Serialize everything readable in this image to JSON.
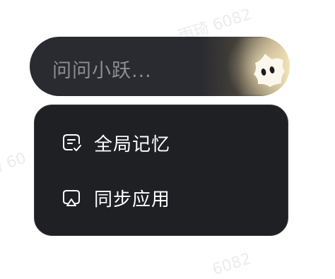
{
  "watermark": {
    "top": "雨琦 6082",
    "left": "琦 60",
    "bottom": "6082"
  },
  "search": {
    "placeholder": "问问小跃..."
  },
  "menu": {
    "items": [
      {
        "label": "全局记忆",
        "icon": "memory-chat-check-icon"
      },
      {
        "label": "同步应用",
        "icon": "airplay-screen-icon"
      }
    ]
  }
}
